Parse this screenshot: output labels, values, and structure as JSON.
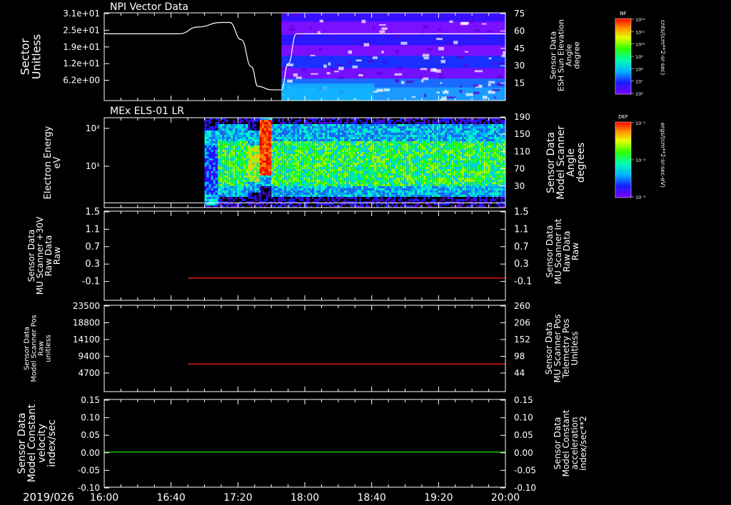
{
  "colors": {
    "background": "#000000",
    "axis": "#ffffff",
    "sector_line": "#ffffff",
    "scanner_lines": "#ff2020",
    "model_constant": "#20ff20",
    "red_label": "#ff2020",
    "green_label": "#20ff20"
  },
  "time_axis": {
    "date": "2019/026",
    "tick_labels": [
      "16:00",
      "16:40",
      "17:20",
      "18:00",
      "18:40",
      "19:20",
      "20:00"
    ],
    "start_minutes": 960,
    "end_minutes": 1200
  },
  "colorbars": [
    {
      "title": "NF",
      "unit": "cnts/(cm**2-sr-sec)",
      "tick_labels": [
        "10¹²",
        "10¹¹",
        "10¹⁰",
        "10⁹",
        "10⁸",
        "10⁷",
        "10⁶"
      ]
    },
    {
      "title": "DEF",
      "unit": "ergs/(cm**2-sr-sec-eV)",
      "tick_labels": [
        "10⁻¹",
        "10⁻²",
        "10⁻³"
      ]
    }
  ],
  "chart_data": [
    {
      "type": "line",
      "title": "NPI Vector Data",
      "ylabel": [
        "Sector",
        "Unitless"
      ],
      "y_tick_labels": [
        "3.1e+01",
        "2.5e+01",
        "1.9e+01",
        "1.2e+01",
        "6.2e+00"
      ],
      "ylim": [
        0,
        31
      ],
      "right_ylabel": [
        "Sensor Data",
        "ESH Sun Elevation",
        "Angle",
        "degree"
      ],
      "right_tick_labels": [
        "75",
        "60",
        "45",
        "30",
        "15"
      ],
      "right_ylim": [
        0,
        75
      ],
      "overlay_spectrogram": {
        "start": "17:46",
        "end": "20:00",
        "note": "NF colour-coded"
      },
      "series": [
        {
          "x": [
            "16:00",
            "16:45",
            "16:56",
            "17:10",
            "17:15",
            "17:22",
            "17:28",
            "17:32",
            "17:40",
            "17:46",
            "17:50",
            "17:55",
            "20:00"
          ],
          "values": [
            23.6,
            23.6,
            26.0,
            27.6,
            27.6,
            21.5,
            12.0,
            5.0,
            3.8,
            3.8,
            13.0,
            23.6,
            23.6
          ]
        }
      ]
    },
    {
      "type": "heatmap",
      "title": "MEx ELS-01 LR",
      "ylabel": [
        "Electron Energy",
        "eV"
      ],
      "y_tick_labels": [
        "10²",
        "10¹"
      ],
      "y_scale": "log",
      "right_ylabel": [
        "Sensor Data",
        "Model Scanner",
        "Angle",
        "degrees"
      ],
      "right_tick_labels": [
        "190",
        "150",
        "110",
        "70",
        "30"
      ],
      "right_ylim": [
        0,
        190
      ],
      "segments": [
        {
          "start": "17:00",
          "end": "17:08",
          "level": "low"
        },
        {
          "start": "17:08",
          "end": "17:26",
          "level": "medium"
        },
        {
          "start": "17:26",
          "end": "17:33",
          "level": "medium-high"
        },
        {
          "start": "17:33",
          "end": "17:40",
          "level": "very-high"
        },
        {
          "start": "17:40",
          "end": "20:00",
          "level": "medium"
        }
      ],
      "baseline_angle": 10
    },
    {
      "type": "line",
      "ylabel": [
        "Sensor Data",
        "MU Scanner +30V",
        "Raw Data",
        "Raw"
      ],
      "y_tick_labels": [
        "1.5",
        "1.1",
        "0.7",
        "0.3",
        "-0.1"
      ],
      "ylim": [
        -0.5,
        1.5
      ],
      "right_ylabel": [
        "Sensor Data",
        "MU Scanner Int",
        "Raw Data",
        "Raw"
      ],
      "right_tick_labels": [
        "1.5",
        "1.1",
        "0.7",
        "0.3",
        "-0.1"
      ],
      "series": [
        {
          "x": [
            "16:50",
            "20:00"
          ],
          "values": [
            0.0,
            0.0
          ]
        }
      ]
    },
    {
      "type": "line",
      "ylabel": [
        "Sensor Data",
        "Model Scanner Pos",
        "Raw",
        "unitless"
      ],
      "y_tick_labels": [
        "23500",
        "18800",
        "14100",
        "9400",
        "4700"
      ],
      "ylim": [
        0,
        23500
      ],
      "right_ylabel": [
        "Sensor Data",
        "MU Scanner Pos",
        "Telemetry Pos",
        "Unitless"
      ],
      "right_tick_labels": [
        "260",
        "206",
        "152",
        "98",
        "44"
      ],
      "series": [
        {
          "x": [
            "16:50",
            "20:00"
          ],
          "values": [
            7500,
            7500
          ]
        }
      ]
    },
    {
      "type": "line",
      "ylabel": [
        "Sensor Data",
        "Model Constant",
        "velocity",
        "index/sec"
      ],
      "y_tick_labels": [
        "0.15",
        "0.10",
        "0.05",
        "0.00",
        "-0.05",
        "-0.10"
      ],
      "ylim": [
        -0.1,
        0.15
      ],
      "right_ylabel": [
        "Sensor Data",
        "Model Constant",
        "acceleration",
        "index/sec**2"
      ],
      "right_tick_labels": [
        "0.15",
        "0.10",
        "0.05",
        "0.00",
        "-0.05",
        "-0.10"
      ],
      "series": [
        {
          "x": [
            "16:00",
            "20:00"
          ],
          "values": [
            0.0,
            0.0
          ]
        }
      ]
    }
  ]
}
